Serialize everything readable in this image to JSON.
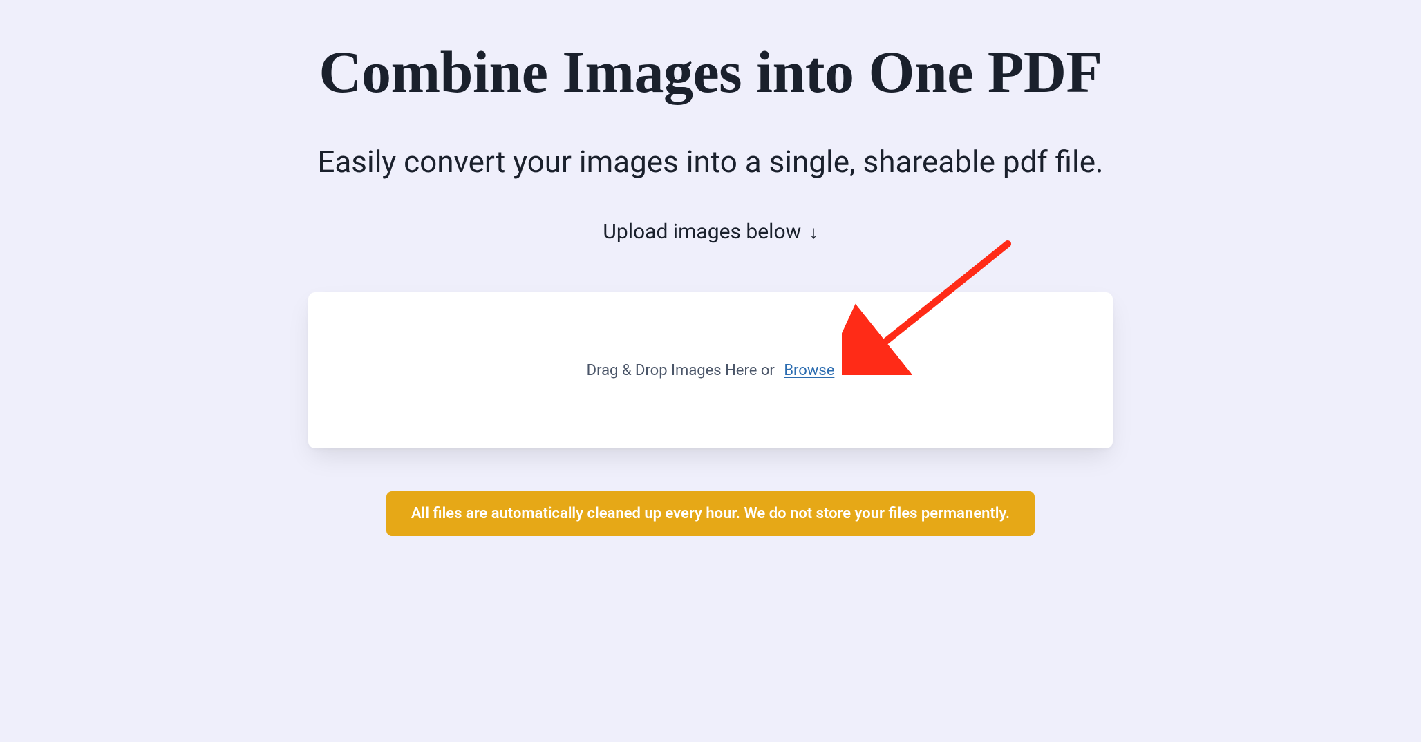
{
  "header": {
    "title": "Combine Images into One PDF",
    "subtitle": "Easily convert your images into a single, shareable pdf file.",
    "upload_label": "Upload images below",
    "upload_arrow": "↓"
  },
  "dropzone": {
    "text": "Drag & Drop Images Here or",
    "browse_label": "Browse"
  },
  "notice": {
    "text": "All files are automatically cleaned up every hour. We do not store your files permanently."
  },
  "annotation": {
    "type": "arrow",
    "color": "#ff2b17"
  }
}
